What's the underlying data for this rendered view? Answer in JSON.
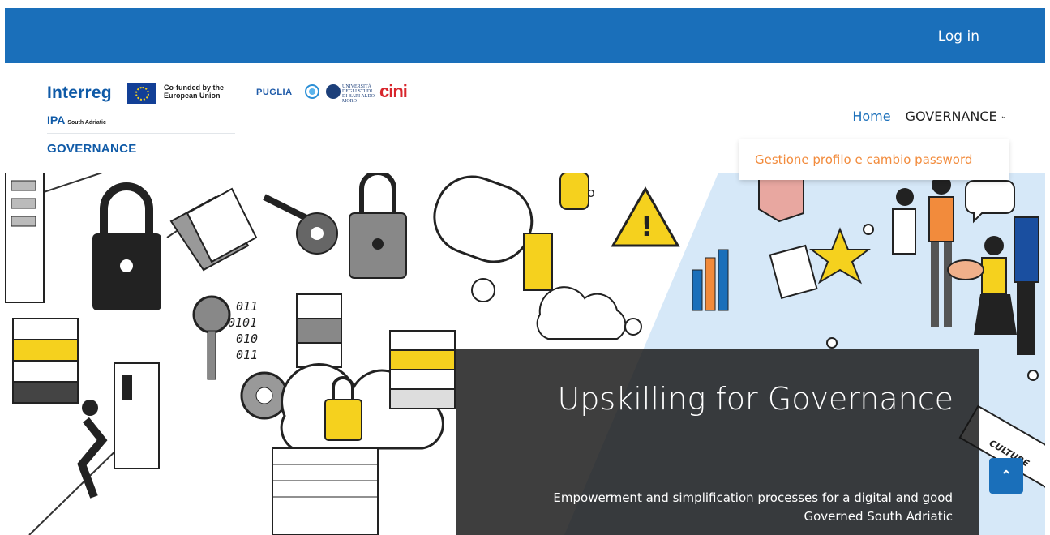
{
  "topbar": {
    "login_label": "Log in"
  },
  "logos": {
    "interreg": "Interreg",
    "cofunded": "Co-funded by the European Union",
    "ipa": "IPA",
    "ipa_region": "South Adriatic",
    "puglia": "PUGLIA",
    "uniba": "UNIVERSITÀ DEGLI STUDI DI BARI ALDO MORO",
    "cini": "cini",
    "project": "GOVERNANCE"
  },
  "nav": {
    "home": "Home",
    "governance": "GOVERNANCE",
    "governance_open": true
  },
  "dropdown": {
    "items": [
      "Gestione profilo e cambio password"
    ]
  },
  "hero": {
    "title": "Upskilling for Governance",
    "subtitle": "Empowerment and simplification processes for a digital and good Governed South Adriatic",
    "decor_text": "CULTURE",
    "binary_text": [
      "011",
      "0101",
      "010",
      "011"
    ]
  },
  "colors": {
    "primary": "#1a6fba",
    "accent_orange": "#f28b3c",
    "caption_bg": "#141414",
    "illustration_yellow": "#f5d11e",
    "illustration_blue": "#d6e8f8"
  },
  "icons": {
    "back_to_top": "chevron-up-icon",
    "dropdown": "chevron-down-icon"
  }
}
